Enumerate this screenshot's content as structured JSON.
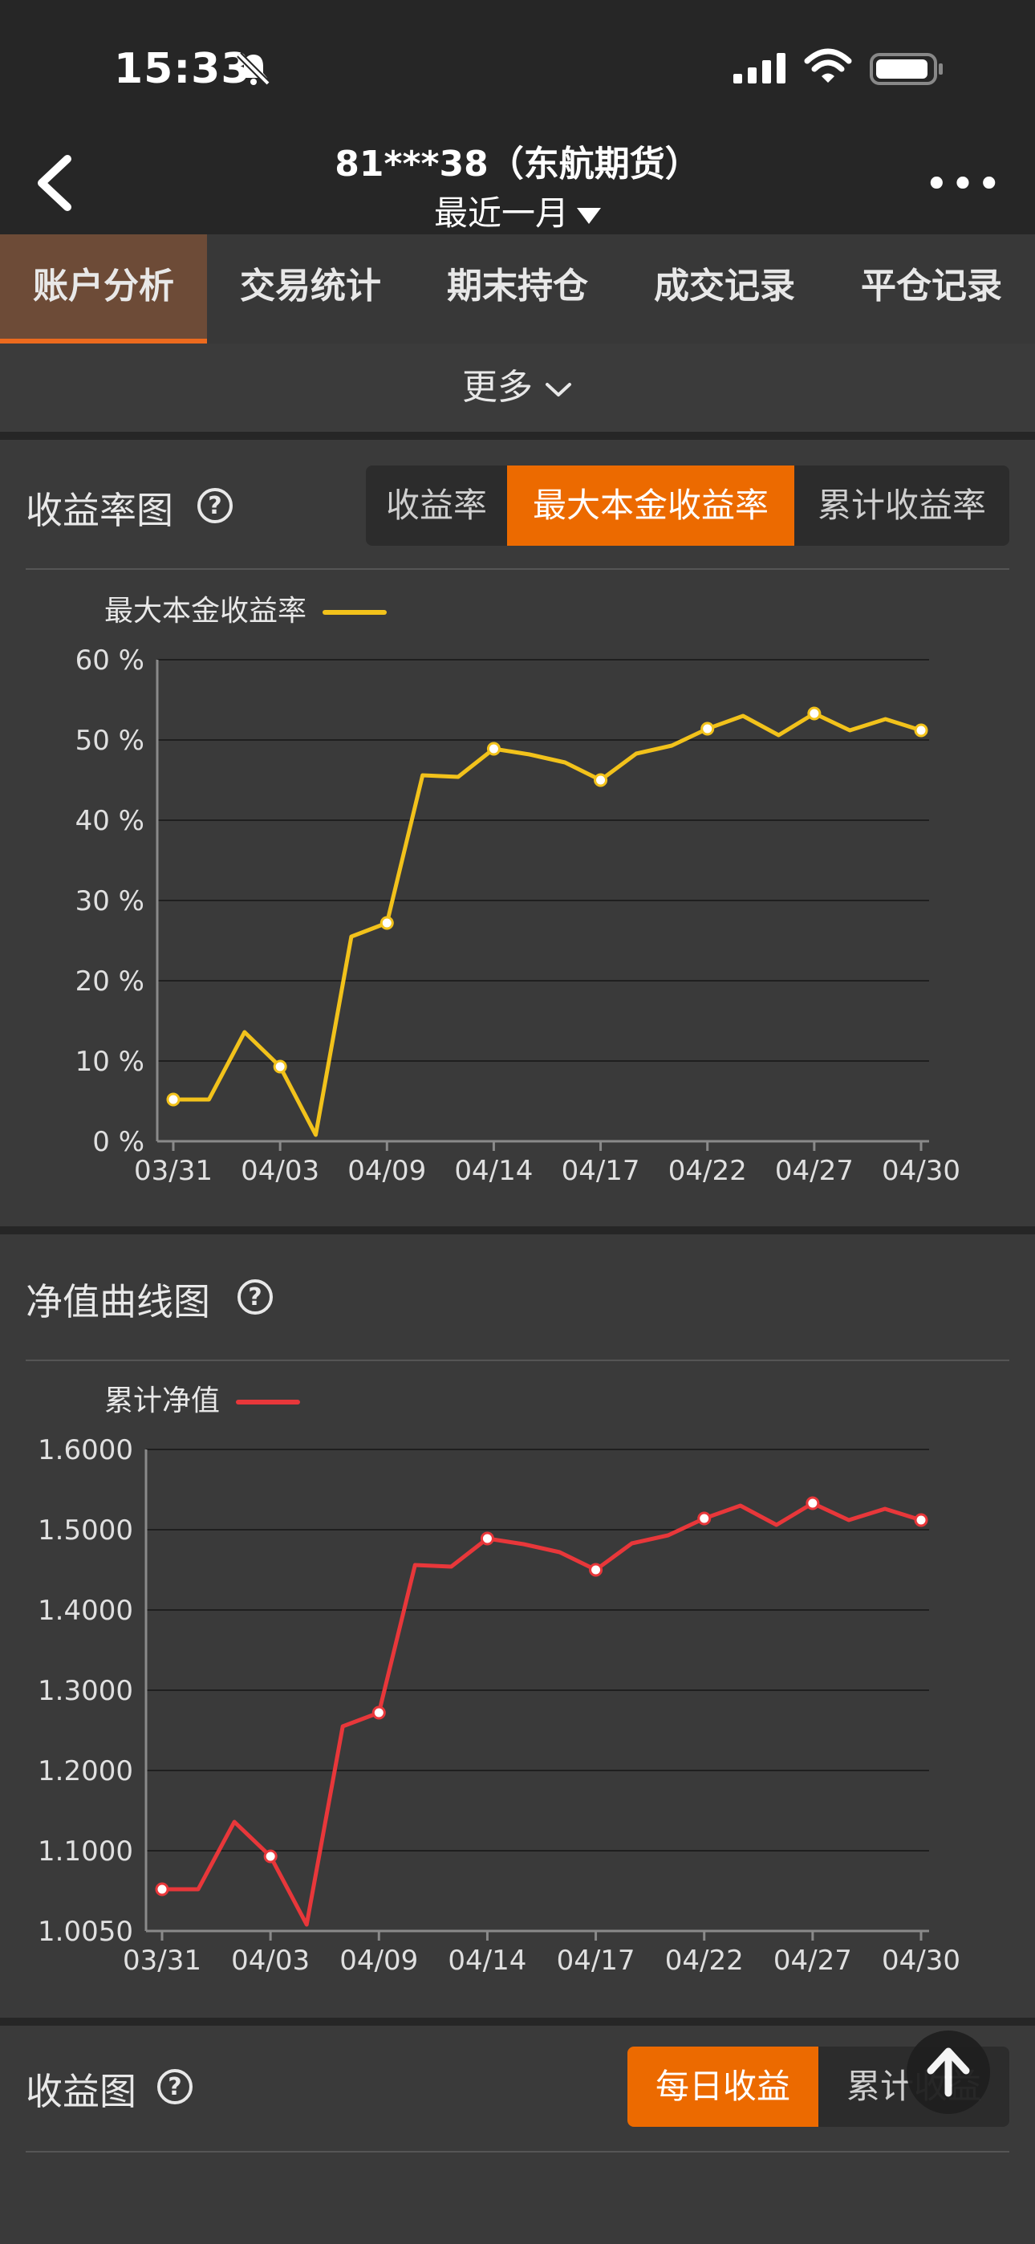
{
  "status": {
    "time": "15:33"
  },
  "header": {
    "account": "81***38（东航期货）",
    "period": "最近一月"
  },
  "tabs": [
    "账户分析",
    "交易统计",
    "期末持仓",
    "成交记录",
    "平仓记录"
  ],
  "more_label": "更多",
  "yield_chart": {
    "title": "收益率图",
    "segments": [
      "收益率",
      "最大本金收益率",
      "累计收益率"
    ],
    "active_segment": 1,
    "legend": "最大本金收益率",
    "color": "#f2c21b"
  },
  "nav_chart": {
    "title": "净值曲线图",
    "legend": "累计净值",
    "color": "#e8373a"
  },
  "profit_chart": {
    "title": "收益图",
    "segments": [
      "每日收益",
      "累计收益"
    ],
    "active_segment": 0
  },
  "chart_data": [
    {
      "type": "line",
      "title": "",
      "series": [
        {
          "name": "最大本金收益率",
          "values": [
            5.2,
            5.2,
            13.6,
            9.3,
            0.8,
            25.5,
            27.2,
            45.6,
            45.4,
            48.9,
            48.2,
            47.2,
            45.0,
            48.3,
            49.3,
            51.4,
            53.0,
            50.6,
            53.3,
            51.2,
            52.6,
            51.2
          ]
        }
      ],
      "x_ticks": [
        "03/31",
        "04/03",
        "04/09",
        "04/14",
        "04/17",
        "04/22",
        "04/27",
        "04/30"
      ],
      "y_ticks": [
        "0 %",
        "10 %",
        "20 %",
        "30 %",
        "40 %",
        "50 %",
        "60 %"
      ],
      "ylim": [
        0,
        60
      ],
      "marked_points": [
        0,
        3,
        6,
        9,
        12,
        15,
        18,
        21
      ]
    },
    {
      "type": "line",
      "title": "",
      "series": [
        {
          "name": "累计净值",
          "values": [
            1.052,
            1.052,
            1.136,
            1.093,
            1.008,
            1.255,
            1.272,
            1.456,
            1.454,
            1.489,
            1.482,
            1.472,
            1.45,
            1.483,
            1.493,
            1.514,
            1.53,
            1.506,
            1.533,
            1.512,
            1.526,
            1.512
          ]
        }
      ],
      "x_ticks": [
        "03/31",
        "04/03",
        "04/09",
        "04/14",
        "04/17",
        "04/22",
        "04/27",
        "04/30"
      ],
      "y_ticks": [
        "1.0050",
        "1.1000",
        "1.2000",
        "1.3000",
        "1.4000",
        "1.5000",
        "1.6000"
      ],
      "ylim": [
        1.0,
        1.6
      ],
      "marked_points": [
        0,
        3,
        6,
        9,
        12,
        15,
        18,
        21
      ]
    }
  ]
}
